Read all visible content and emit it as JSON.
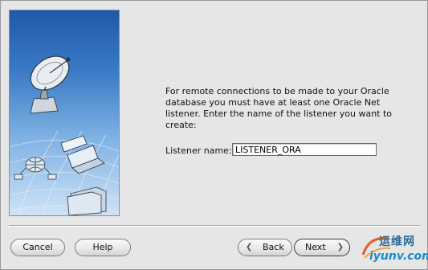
{
  "wizard": {
    "description": "For remote connections to be made to your Oracle database you must have at least one Oracle Net listener. Enter the name of the listener you want to create:",
    "listener_label": "Listener name:",
    "listener_value": "LISTENER_ORA"
  },
  "buttons": {
    "cancel": "Cancel",
    "help": "Help",
    "back": "Back",
    "next": "Next"
  },
  "icons": {
    "back_arrow": "chevron-left-icon",
    "next_arrow": "chevron-right-icon",
    "side_panel": [
      "satellite-dish-icon",
      "globe-network-icon",
      "laptop-icon",
      "folder-icon"
    ]
  },
  "watermark": {
    "line1": "运维网",
    "line2": "iyunv.com"
  }
}
